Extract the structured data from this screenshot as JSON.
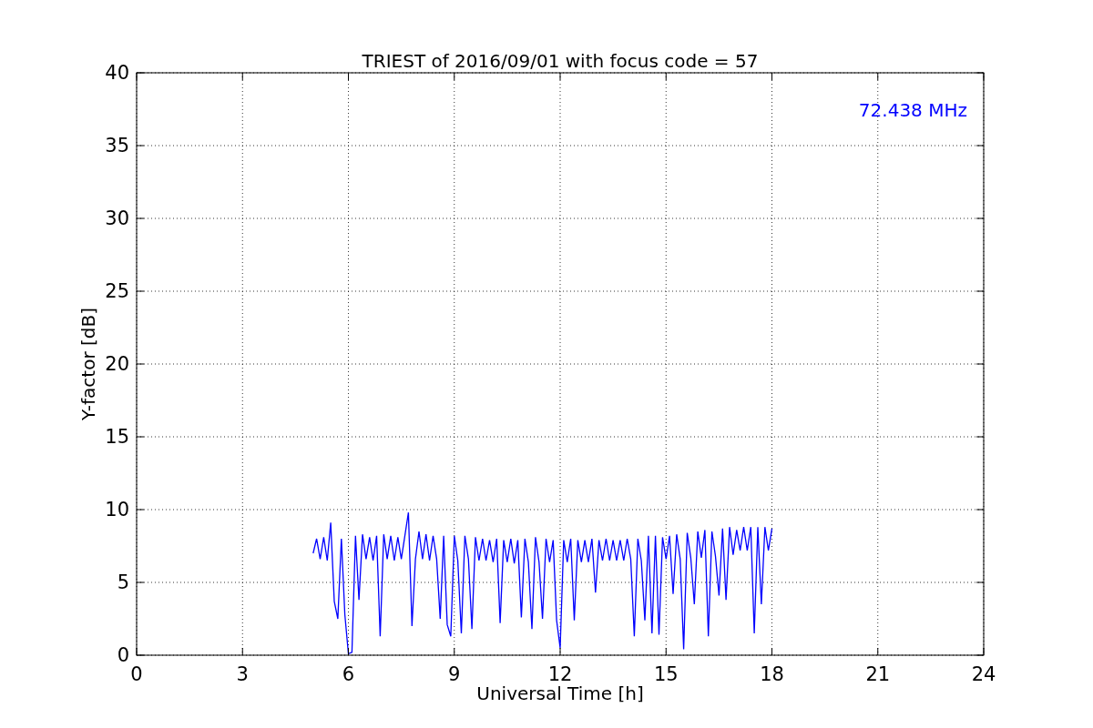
{
  "chart_data": {
    "type": "line",
    "title": "TRIEST of 2016/09/01 with focus code = 57",
    "xlabel": "Universal Time [h]",
    "ylabel": "Y-factor [dB]",
    "x": [
      5.0,
      5.1,
      5.2,
      5.3,
      5.4,
      5.5,
      5.6,
      5.7,
      5.8,
      5.9,
      6.0,
      6.1,
      6.2,
      6.3,
      6.4,
      6.5,
      6.6,
      6.7,
      6.8,
      6.9,
      7.0,
      7.1,
      7.2,
      7.3,
      7.4,
      7.5,
      7.6,
      7.7,
      7.8,
      7.9,
      8.0,
      8.1,
      8.2,
      8.3,
      8.4,
      8.5,
      8.6,
      8.7,
      8.8,
      8.9,
      9.0,
      9.1,
      9.2,
      9.3,
      9.4,
      9.5,
      9.6,
      9.7,
      9.8,
      9.9,
      10.0,
      10.1,
      10.2,
      10.3,
      10.4,
      10.5,
      10.6,
      10.7,
      10.8,
      10.9,
      11.0,
      11.1,
      11.2,
      11.3,
      11.4,
      11.5,
      11.6,
      11.7,
      11.8,
      11.9,
      12.0,
      12.1,
      12.2,
      12.3,
      12.4,
      12.5,
      12.6,
      12.7,
      12.8,
      12.9,
      13.0,
      13.1,
      13.2,
      13.3,
      13.4,
      13.5,
      13.6,
      13.7,
      13.8,
      13.9,
      14.0,
      14.1,
      14.2,
      14.3,
      14.4,
      14.5,
      14.6,
      14.7,
      14.8,
      14.9,
      15.0,
      15.1,
      15.2,
      15.3,
      15.4,
      15.5,
      15.6,
      15.7,
      15.8,
      15.9,
      16.0,
      16.1,
      16.2,
      16.3,
      16.4,
      16.5,
      16.6,
      16.7,
      16.8,
      16.9,
      17.0,
      17.1,
      17.2,
      17.3,
      17.4,
      17.5,
      17.6,
      17.7,
      17.8,
      17.9,
      18.0
    ],
    "series": [
      {
        "color": "#0000ff",
        "values": [
          7.0,
          8.0,
          6.6,
          8.1,
          6.5,
          9.1,
          3.7,
          2.5,
          8.0,
          2.8,
          0.1,
          0.2,
          8.2,
          3.8,
          8.3,
          6.6,
          8.1,
          6.5,
          8.2,
          1.3,
          8.3,
          6.6,
          8.2,
          6.5,
          8.1,
          6.6,
          8.2,
          9.8,
          2.0,
          6.6,
          8.5,
          6.6,
          8.3,
          6.5,
          8.2,
          6.6,
          2.5,
          8.2,
          2.1,
          1.3,
          8.2,
          6.5,
          1.5,
          8.2,
          6.6,
          1.8,
          8.1,
          6.5,
          8.0,
          6.5,
          7.9,
          6.4,
          8.0,
          2.2,
          7.9,
          6.4,
          8.0,
          6.3,
          7.9,
          2.6,
          8.0,
          6.4,
          1.8,
          8.1,
          6.4,
          2.5,
          8.0,
          6.4,
          7.9,
          2.4,
          0.5,
          7.9,
          6.4,
          8.0,
          2.4,
          7.9,
          6.4,
          7.9,
          6.4,
          8.0,
          4.3,
          7.9,
          6.5,
          8.0,
          6.5,
          7.9,
          6.5,
          7.9,
          6.5,
          8.0,
          6.6,
          1.3,
          8.0,
          6.5,
          2.4,
          8.2,
          1.5,
          8.2,
          1.4,
          8.1,
          6.6,
          8.2,
          4.2,
          8.3,
          6.6,
          0.4,
          8.4,
          6.7,
          3.5,
          8.5,
          6.7,
          8.6,
          1.3,
          8.5,
          6.8,
          4.1,
          8.7,
          3.8,
          8.8,
          6.9,
          8.6,
          7.2,
          8.8,
          7.2,
          8.8,
          1.5,
          8.8,
          3.5,
          8.8,
          7.2,
          8.7
        ]
      }
    ],
    "xlim": [
      0,
      24
    ],
    "ylim": [
      0,
      40
    ],
    "xticks": [
      0,
      3,
      6,
      9,
      12,
      15,
      18,
      21,
      24
    ],
    "yticks": [
      0,
      5,
      10,
      15,
      20,
      25,
      30,
      35,
      40
    ],
    "grid": true,
    "annotations": [
      "72.438 MHz"
    ]
  }
}
